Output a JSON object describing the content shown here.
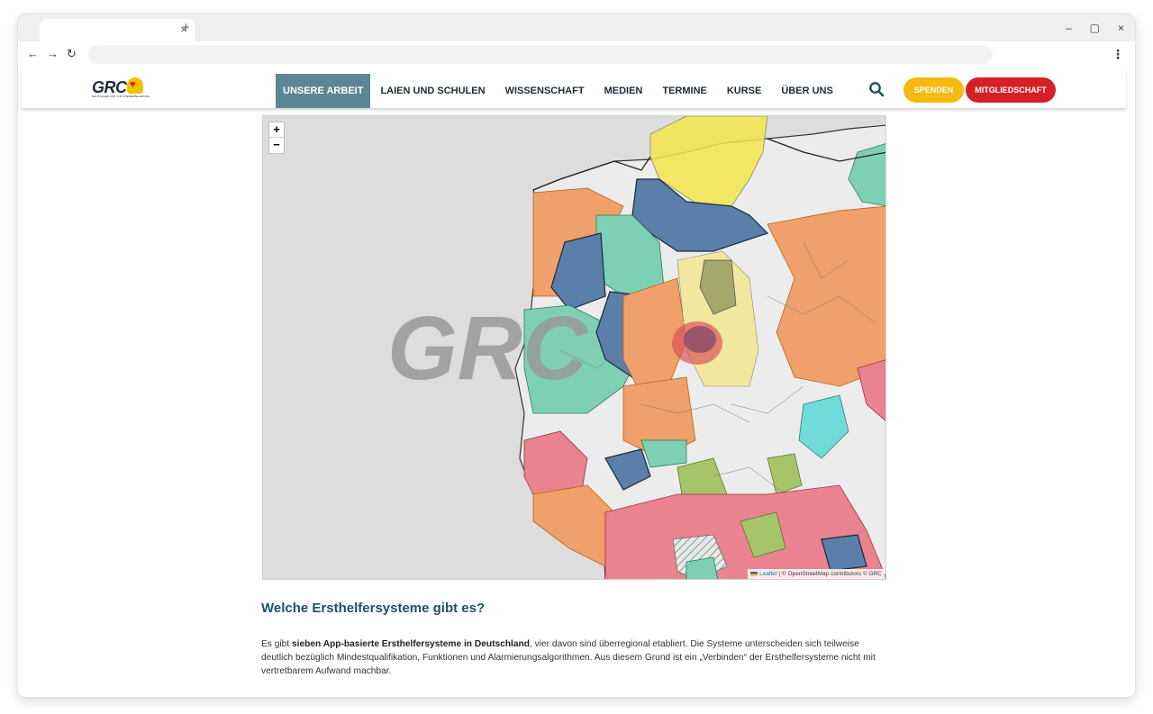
{
  "browser": {
    "tab_close": "×",
    "new_tab": "+",
    "back": "←",
    "forward": "→",
    "reload": "↻",
    "menu": "⋮",
    "window_controls": [
      "–",
      "▢",
      "×"
    ]
  },
  "site": {
    "logo_text": "GRC",
    "logo_subtitle": "DEUTSCHER RAT FÜR WIEDERBELEBUNG",
    "nav": [
      {
        "label": "UNSERE ARBEIT",
        "active": true
      },
      {
        "label": "LAIEN UND SCHULEN",
        "active": false
      },
      {
        "label": "WISSENSCHAFT",
        "active": false
      },
      {
        "label": "MEDIEN",
        "active": false
      },
      {
        "label": "TERMINE",
        "active": false
      },
      {
        "label": "KURSE",
        "active": false
      },
      {
        "label": "ÜBER UNS",
        "active": false
      }
    ],
    "spenden": "SPENDEN",
    "mitgliedschaft": "MITGLIEDSCHAFT",
    "colors": {
      "nav_active": "#5a8793",
      "spenden": "#f5b90f",
      "mitgliedschaft": "#d61f26",
      "heading": "#1c5363"
    }
  },
  "map": {
    "zoom_in": "+",
    "zoom_out": "−",
    "watermark": "GRC",
    "attribution_leaflet": "Leaflet",
    "attribution_rest": " | © OpenStreetMap contributors © GRC"
  },
  "article": {
    "heading": "Welche Ersthelfersysteme gibt es?",
    "para_pre": "Es gibt ",
    "para_bold": "sieben App-basierte Ersthelfersysteme in Deutschland",
    "para_post": ", vier davon sind überregional etabliert. Die Systeme unterscheiden sich teilweise deutlich bezüglich Mindestqualifikation, Funktionen und Alarmierungsalgorithmen. Aus diesem Grund ist ein „Verbinden“ der Ersthelfersysteme nicht mit vertretbarem Aufwand machbar."
  }
}
